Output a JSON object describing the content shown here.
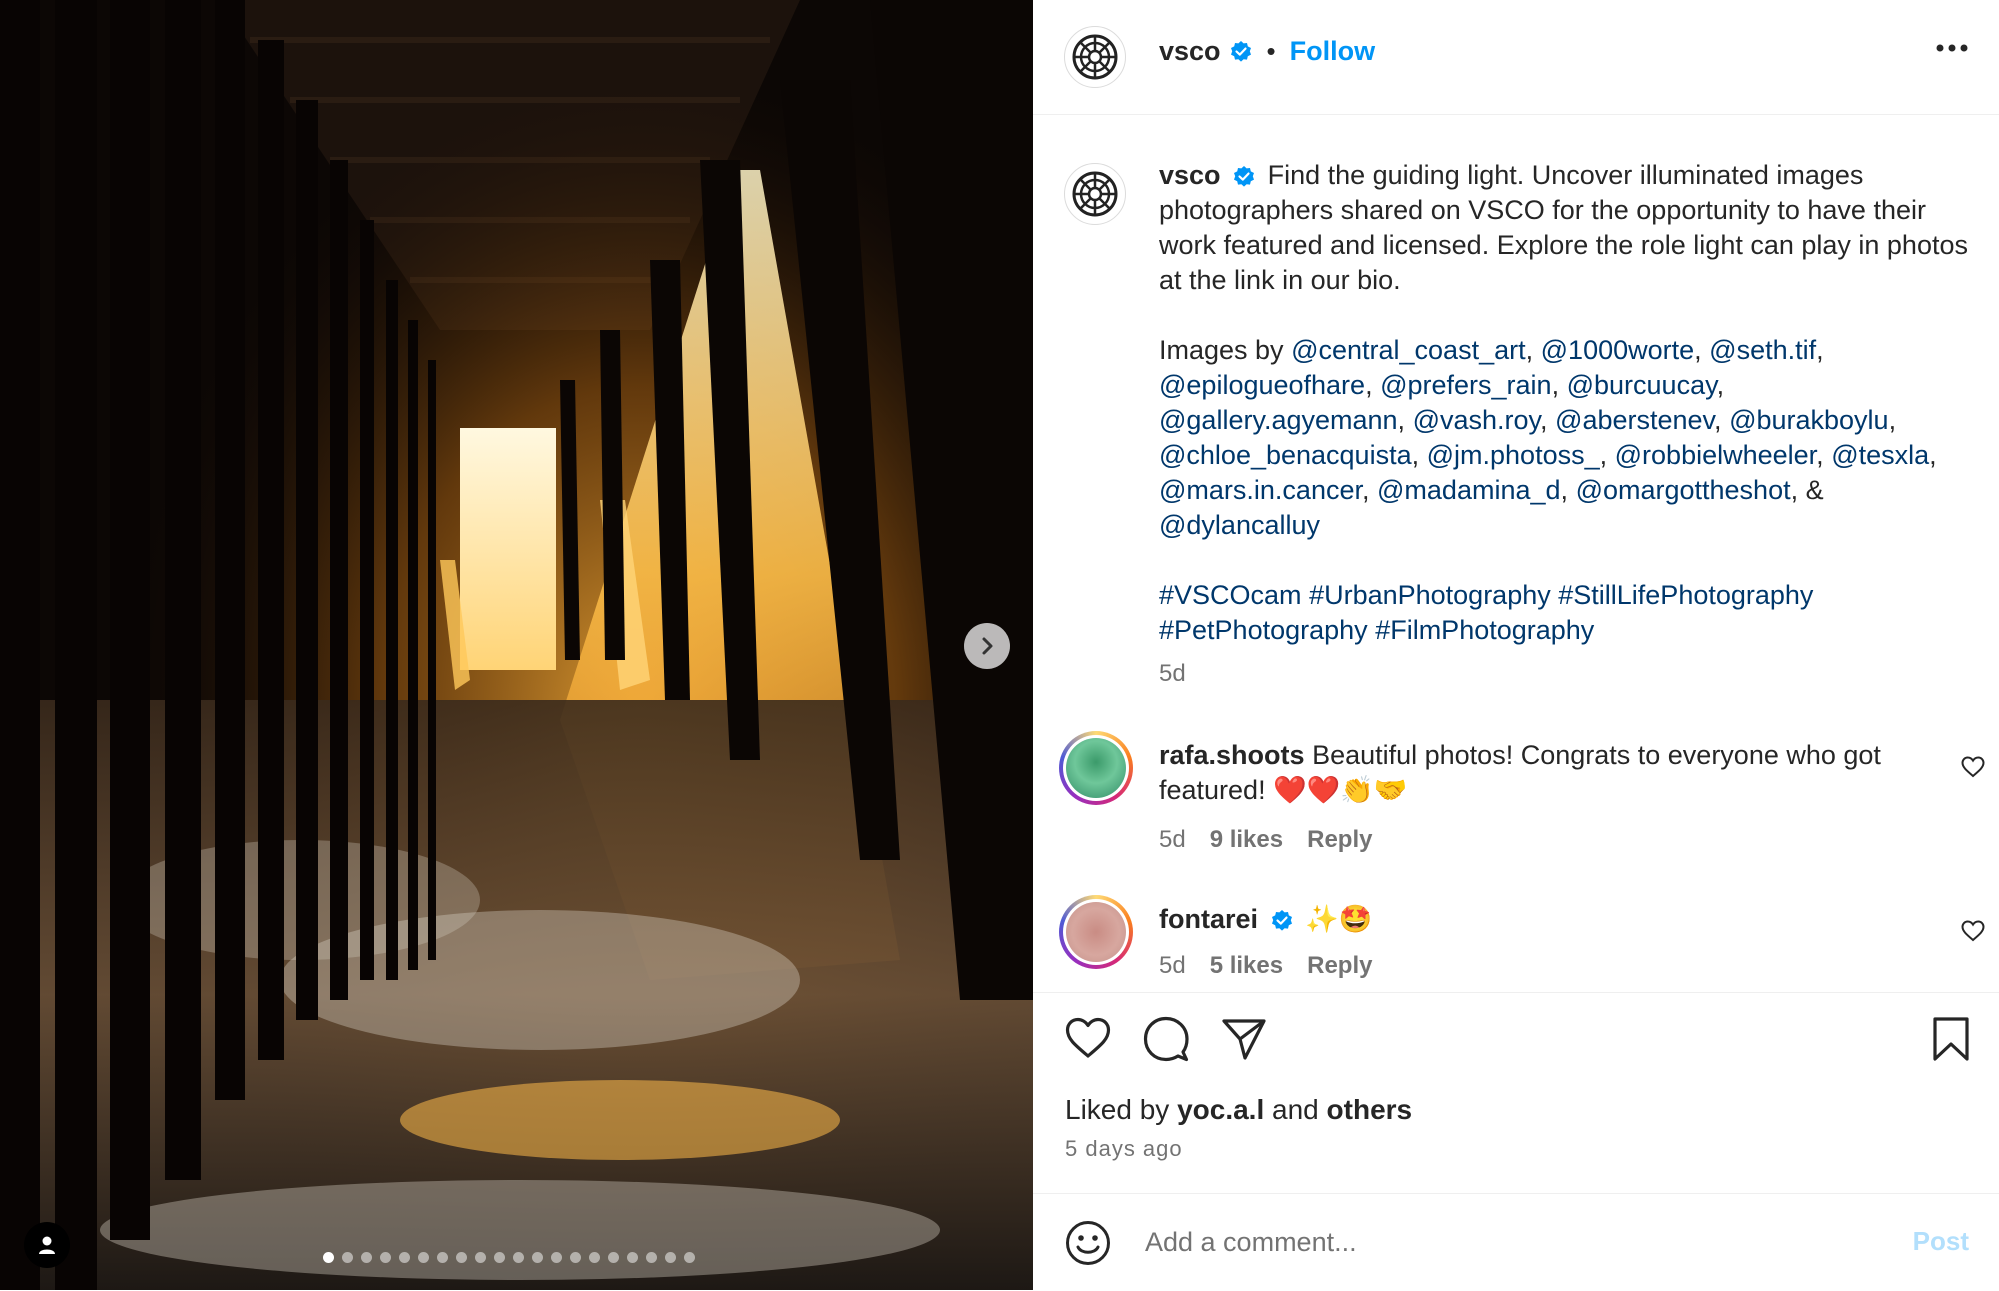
{
  "post": {
    "username": "vsco",
    "separator": "•",
    "follow_label": "Follow",
    "caption_text": "Find the guiding light. Uncover illuminated images photographers shared on VSCO for the opportunity to have their work featured and licensed. Explore the role light can play in photos at the link in our bio.",
    "images_by_label": "Images by",
    "credits": [
      "@central_coast_art",
      "@1000worte",
      "@seth.tif",
      "@epilogueofhare",
      "@prefers_rain",
      "@burcuucay",
      "@gallery.agyemann",
      "@vash.roy",
      "@aberstenev",
      "@burakboylu",
      "@chloe_benacquista",
      "@jm.photoss_",
      "@robbielwheeler",
      "@tesxla",
      "@mars.in.cancer",
      "@madamina_d",
      "@omargottheshot",
      "&",
      "@dylancalluy"
    ],
    "hashtags": [
      "#VSCOcam",
      "#UrbanPhotography",
      "#StillLifePhotography",
      "#PetPhotography",
      "#FilmPhotography"
    ],
    "caption_age": "5d"
  },
  "comments": [
    {
      "username": "rafa.shoots",
      "text": "Beautiful photos! Congrats to everyone who got featured! ❤️❤️👏🤝",
      "age": "5d",
      "likes": "9 likes",
      "reply_label": "Reply",
      "verified": false
    },
    {
      "username": "fontarei",
      "text": "✨🤩",
      "age": "5d",
      "likes": "5 likes",
      "reply_label": "Reply",
      "verified": true
    }
  ],
  "likes": {
    "prefix": "Liked by",
    "user": "yoc.a.l",
    "conj": "and",
    "others": "others",
    "time_ago": "5 days ago"
  },
  "comment_box": {
    "placeholder": "Add a comment...",
    "post_label": "Post"
  },
  "carousel": {
    "total_slides": 20,
    "active_index": 0
  },
  "colors": {
    "accent": "#0095f6",
    "link": "#00376b",
    "verified": "#0095f6",
    "post_disabled": "#b2dffc"
  },
  "icons": [
    "vsco-logo-icon",
    "verified-icon",
    "more-icon",
    "chevron-right-icon",
    "user-tag-icon",
    "heart-icon",
    "comment-icon",
    "share-icon",
    "bookmark-icon",
    "emoji-icon"
  ]
}
